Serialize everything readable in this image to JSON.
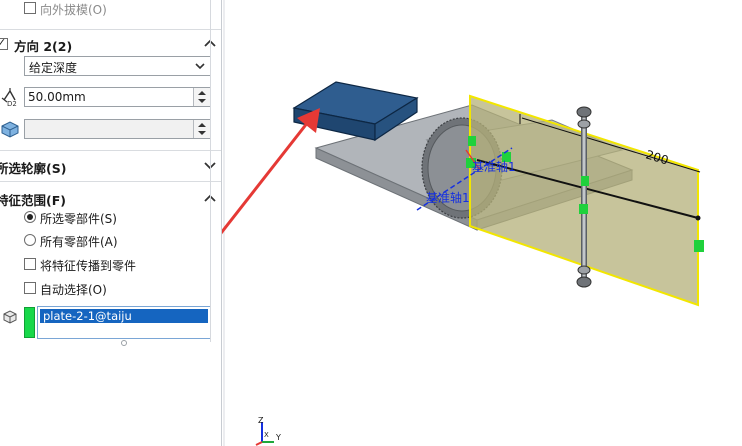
{
  "draft_outward": {
    "label": "向外拔模(O)",
    "checked": false
  },
  "direction2": {
    "title": "方向 2(2)",
    "end_condition": "给定深度",
    "depth_value": "50.00mm",
    "depth_icon_label": "D2",
    "draft_value": ""
  },
  "selected_contours": {
    "title": "所选轮廓(S)"
  },
  "feature_scope": {
    "title": "特征范围(F)",
    "options": [
      {
        "label": "所选零部件(S)",
        "selected": true
      },
      {
        "label": "所有零部件(A)",
        "selected": false
      }
    ],
    "propagate": {
      "label": "将特征传播到零件",
      "checked": false
    },
    "auto_select": {
      "label": "自动选择(O)",
      "checked": false
    },
    "selection_list": [
      "plate-2-1@taiju"
    ],
    "swatch_color": "#18d84a"
  },
  "viewport": {
    "dimension_label": "200",
    "axis_labels": [
      "基准轴1",
      "基准轴1"
    ],
    "triad_labels": [
      "Z",
      "Y",
      "X"
    ],
    "colors": {
      "selected_body": "#2f5d8f",
      "plate": "#a9aeb3",
      "plane": "#b4b07a",
      "plane_edge": "#f2e600",
      "arrow": "#e53935",
      "axis": "#1530e0",
      "handle": "#1fd13c"
    }
  }
}
